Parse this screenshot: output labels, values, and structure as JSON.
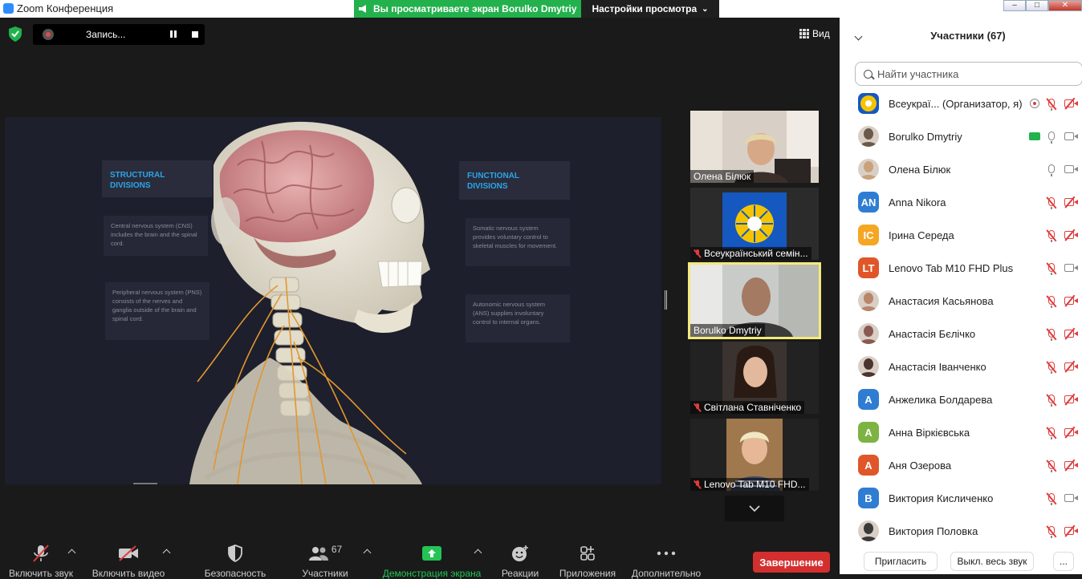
{
  "window": {
    "title": "Zoom Конференция"
  },
  "share_banner": {
    "text": "Вы просматриваете экран Borulko Dmytriy",
    "view_settings": "Настройки просмотра"
  },
  "recording": {
    "label": "Запись..."
  },
  "view_button": {
    "label": "Вид"
  },
  "slide": {
    "structural_heading": "STRUCTURAL DIVISIONS",
    "functional_heading": "FUNCTIONAL DIVISIONS",
    "cns_text": "Central nervous system (CNS) includes the brain and the spinal cord.",
    "pns_text": "Peripheral nervous system (PNS) consists of the nerves and ganglia outside of the brain and spinal cord.",
    "somatic_text": "Somatic nervous system provides voluntary control to skeletal muscles for movement.",
    "ans_text": "Autonomic nervous system (ANS) supplies involuntary control to internal organs."
  },
  "thumbnails": [
    {
      "name": "Олена Білюк",
      "muted": false,
      "active": false
    },
    {
      "name": "Всеукраїнський семін...",
      "muted": true,
      "active": false
    },
    {
      "name": "Borulko Dmytriy",
      "muted": false,
      "active": true
    },
    {
      "name": "Світлана Ставніченко",
      "muted": true,
      "active": false
    },
    {
      "name": "Lenovo Tab M10 FHD...",
      "muted": true,
      "active": false
    }
  ],
  "toolbar": {
    "audio": "Включить звук",
    "video": "Включить видео",
    "security": "Безопасность",
    "participants": "Участники",
    "participants_count": "67",
    "share": "Демонстрация экрана",
    "reactions": "Реакции",
    "apps": "Приложения",
    "more": "Дополнительно",
    "end": "Завершение"
  },
  "participants_panel": {
    "title": "Участники (67)",
    "search_placeholder": "Найти участника",
    "invite": "Пригласить",
    "mute_all": "Выкл. весь звук",
    "more": "...",
    "items": [
      {
        "name": "Всеукраї...  (Организатор, я)",
        "avatar": "logo",
        "color": "#f5c400",
        "sharing": false,
        "recording": true,
        "mic_muted": true,
        "cam_off": true
      },
      {
        "name": "Borulko Dmytriy",
        "avatar": "photo",
        "color": "#6b5a4a",
        "sharing": true,
        "recording": false,
        "mic_muted": false,
        "cam_off": false
      },
      {
        "name": "Олена Білюк",
        "avatar": "photo",
        "color": "#c9a27a",
        "sharing": false,
        "recording": false,
        "mic_muted": false,
        "cam_off": false
      },
      {
        "name": "Anna Nikora",
        "avatar": "AN",
        "color": "#2f7dd3",
        "sharing": false,
        "recording": false,
        "mic_muted": true,
        "cam_off": true
      },
      {
        "name": "Ірина Середа",
        "avatar": "IC",
        "color": "#f5a623",
        "sharing": false,
        "recording": false,
        "mic_muted": true,
        "cam_off": true
      },
      {
        "name": "Lenovo Tab M10 FHD Plus",
        "avatar": "LT",
        "color": "#e0562a",
        "sharing": false,
        "recording": false,
        "mic_muted": true,
        "cam_off": false
      },
      {
        "name": "Анастасия Касьянова",
        "avatar": "photo",
        "color": "#b8866a",
        "sharing": false,
        "recording": false,
        "mic_muted": true,
        "cam_off": true
      },
      {
        "name": "Анастасія Бєлічко",
        "avatar": "photo",
        "color": "#8a5a52",
        "sharing": false,
        "recording": false,
        "mic_muted": true,
        "cam_off": true
      },
      {
        "name": "Анастасія Іванченко",
        "avatar": "photo",
        "color": "#4a3530",
        "sharing": false,
        "recording": false,
        "mic_muted": true,
        "cam_off": true
      },
      {
        "name": "Анжелика Болдарева",
        "avatar": "A",
        "color": "#2f7dd3",
        "sharing": false,
        "recording": false,
        "mic_muted": true,
        "cam_off": true
      },
      {
        "name": "Анна Віркієвська",
        "avatar": "A",
        "color": "#7cb342",
        "sharing": false,
        "recording": false,
        "mic_muted": true,
        "cam_off": true
      },
      {
        "name": "Аня Озерова",
        "avatar": "A",
        "color": "#e0562a",
        "sharing": false,
        "recording": false,
        "mic_muted": true,
        "cam_off": true
      },
      {
        "name": "Виктория Кисличенко",
        "avatar": "B",
        "color": "#2f7dd3",
        "sharing": false,
        "recording": false,
        "mic_muted": true,
        "cam_off": false
      },
      {
        "name": "Виктория Половка",
        "avatar": "photo",
        "color": "#3a3a3a",
        "sharing": false,
        "recording": false,
        "mic_muted": true,
        "cam_off": true
      }
    ]
  }
}
